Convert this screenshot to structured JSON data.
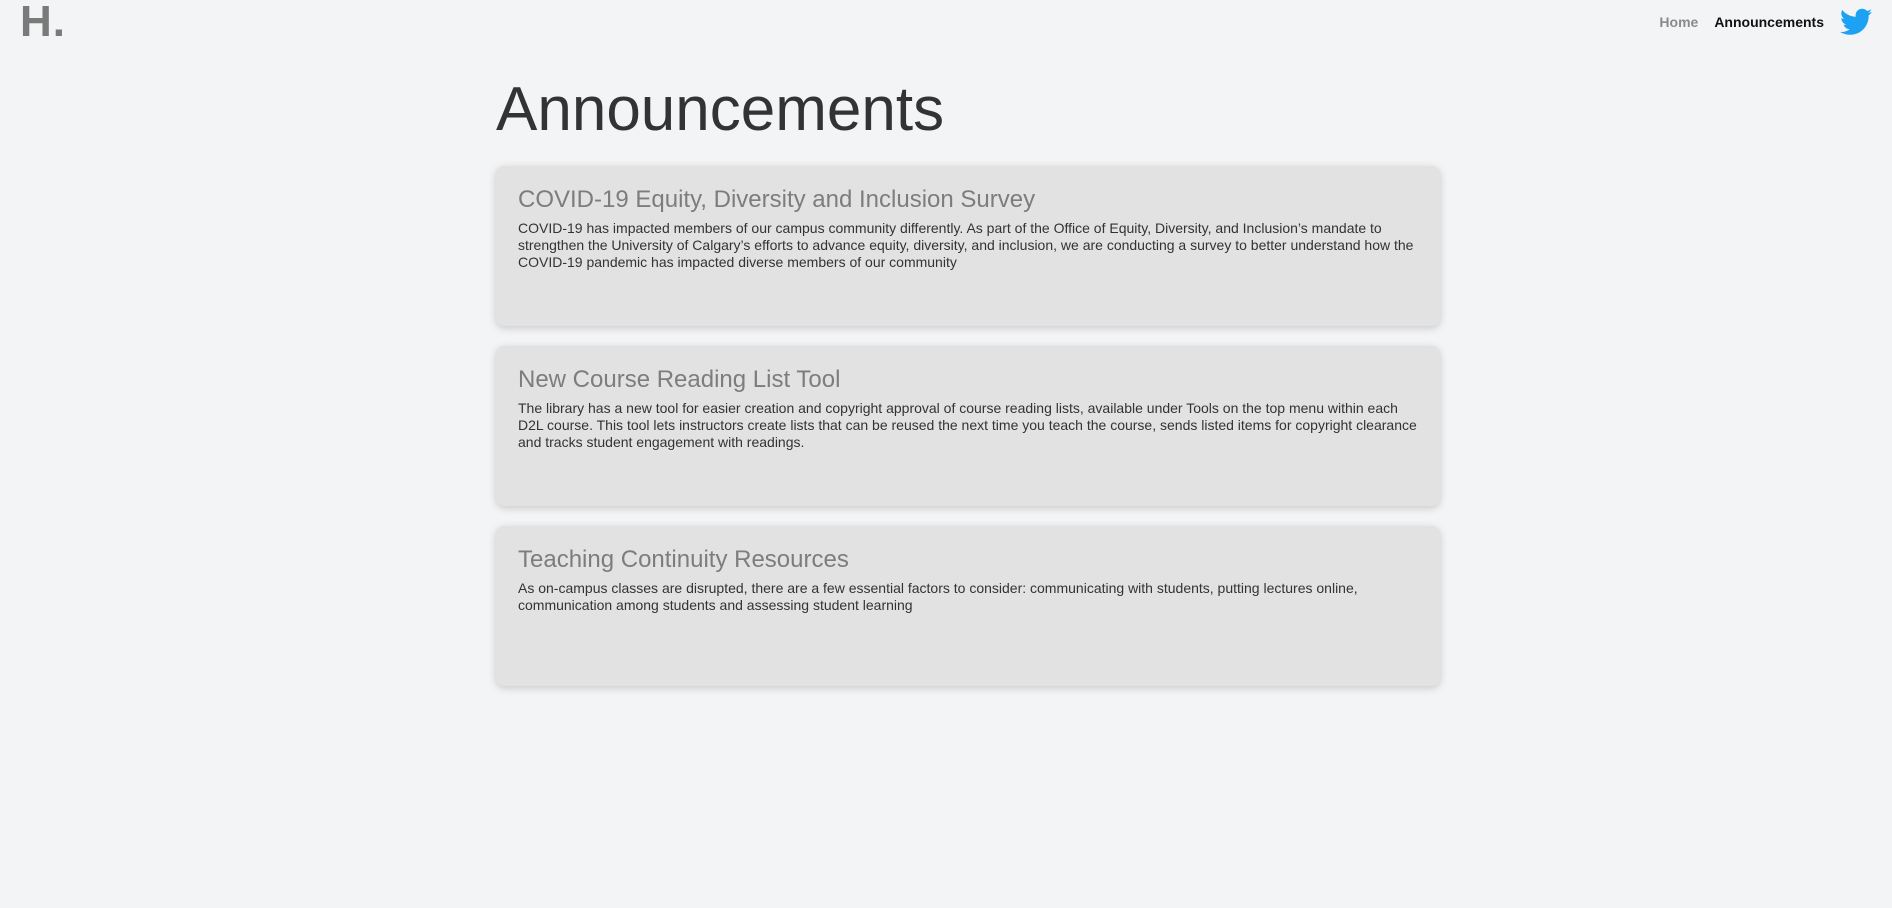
{
  "header": {
    "logo": "H.",
    "nav": [
      {
        "label": "Home"
      },
      {
        "label": "Announcements"
      }
    ],
    "social_icon": "twitter-icon",
    "social_color": "#1da1f2"
  },
  "main": {
    "title": "Announcements",
    "announcements": [
      {
        "title": "COVID-19 Equity, Diversity and Inclusion Survey",
        "body": "COVID-19 has impacted members of our campus community differently. As part of the Office of Equity, Diversity, and Inclusion’s mandate to strengthen the University of Calgary’s efforts to advance equity, diversity, and inclusion, we are conducting a survey to better understand how the COVID-19 pandemic has impacted diverse members of our community"
      },
      {
        "title": "New Course Reading List Tool",
        "body": "The library has a new tool for easier creation and copyright approval of course reading lists, available under Tools on the top menu within each D2L course. This tool lets instructors create lists that can be reused the next time you teach the course, sends listed items for copyright clearance and tracks student engagement with readings."
      },
      {
        "title": "Teaching Continuity Resources",
        "body": "As on-campus classes are disrupted, there are a few essential factors to consider: communicating with students, putting lectures online, communication among students and assessing student learning"
      }
    ]
  },
  "colors": {
    "background": "#f3f4f6",
    "card": "#e2e2e2",
    "card_title": "#7d7d7d",
    "nav_active": "#111111",
    "nav_inactive": "#8a8a8a"
  }
}
